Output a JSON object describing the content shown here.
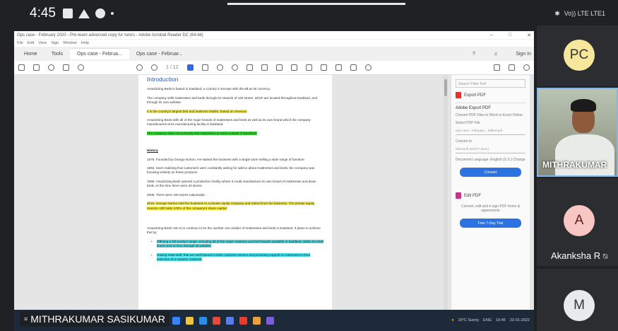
{
  "status_bar": {
    "time": "4:45",
    "network": "Vo)) LTE LTE1"
  },
  "window": {
    "title": "Ops case - February 2020 - Pre-team advanced copy for tutors - Adobe Acrobat Reader DC (64-bit)",
    "menu": [
      "File",
      "Edit",
      "View",
      "Sign",
      "Window",
      "Help"
    ],
    "tabs": [
      "Home",
      "Tools",
      "Ops case - Februa...",
      "Ops case - Februar..."
    ],
    "sign_in": "Sign In",
    "page_indicator": "1 / 12"
  },
  "document": {
    "heading": "Introduction",
    "paras": [
      "Ama222ing Beds is based in Eastland, a country in Europe with the €$ as its currency.",
      "The company sells mattresses and beds through its network of 120 stores, which are located throughout Eastland, and through its own website.",
      "It is the country's largest bed and mattress retailer, based on revenue.",
      "Ama222ing Beds sells all of the major brands of mattresses and beds as well as its own brand which the company manufactures at its manufacturing facility in Eastland.",
      "The company does not currently sell mattresses or beds outside of Eastland."
    ],
    "history_title": "History",
    "history": [
      "1978. Founded by George Norton. He started the business with a single store selling a wide range of furniture.",
      "1992. Seen realising that customers were constantly asking for advice about mattresses and beds, the company was focusing entirely on these products.",
      "1996. Ama222ing Beds opened a production facility where it could manufacture its own brand of mattresses and divan beds. At the time there were 40 stores.",
      "2008. There were 100 stores nationwide.",
      "2015. George Norton sold the business to a private equity company and retired from the business. The private equity investor still holds 100% of the company's share capital."
    ],
    "aim": "Ama222ing Beds' aim is to continue to be the number one retailer of mattresses and beds in Eastland. It plans to achieve this by:",
    "bullets": [
      "Offering a full product range, including all of the major mattress and bed brands available in Eastland, within its retail stores and on-line through its website.",
      "Having retail staff, that are well trained in both customer service and providing support to customers in their selection of a suitable mattress."
    ]
  },
  "right_panel": {
    "search_placeholder": "Search 'Hide Text'",
    "export_label": "Export PDF",
    "title": "Adobe Export PDF",
    "desc": "Convert PDF Files to Word or Excel Online",
    "select_label": "Select PDF File",
    "file": "Ops case - February... Edited.pdf",
    "convert_to": "Convert to",
    "format": "Microsoft Word (*.docx)",
    "language": "Document Language: English (U.S.) Change",
    "convert_btn": "Convert",
    "edit_pdf": "Edit PDF",
    "promo": "Convert, edit and e-sign PDF forms & agreements",
    "trial_btn": "Free 7-Day Trial"
  },
  "taskbar": {
    "weather": "29°C Sunny",
    "lang": "ENG",
    "clock": "16:45",
    "date": "22-01-2022"
  },
  "speaker": {
    "name": "MITHRAKUMAR SASIKUMAR"
  },
  "participants": [
    {
      "initials": "PC",
      "name": ""
    },
    {
      "initials": "",
      "name": "MITHRAKUMAR"
    },
    {
      "initials": "A",
      "name": "Akanksha R"
    },
    {
      "initials": "M",
      "name": ""
    }
  ],
  "colors": {
    "highlight_yellow": "#f7ec3b",
    "highlight_green": "#37d437",
    "highlight_cyan": "#3fdde6",
    "accent_blue": "#2b73e0",
    "active_speaker_border": "#7cb9f4"
  }
}
